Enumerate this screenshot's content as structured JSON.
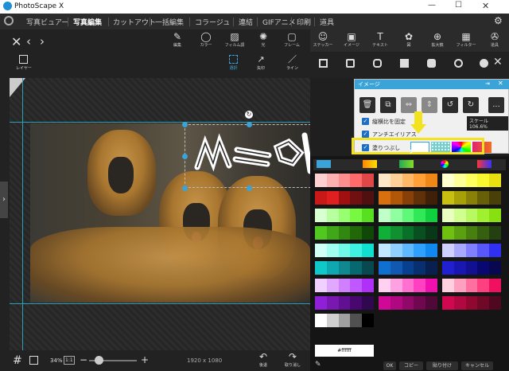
{
  "app": {
    "title": "PhotoScape X",
    "minimize": "—",
    "maximize": "☐",
    "close": "✕"
  },
  "menu": [
    "写真ビュアー",
    "写真編集",
    "カットアウト",
    "一括編集",
    "コラージュ",
    "連結",
    "GIFアニメ",
    "印刷",
    "道具"
  ],
  "toolbar": {
    "items": [
      {
        "label": "編集",
        "icon": "✎"
      },
      {
        "label": "カラー",
        "icon": "◯"
      },
      {
        "label": "フィルム調",
        "icon": "▨"
      },
      {
        "label": "光",
        "icon": "✺"
      },
      {
        "label": "フレーム",
        "icon": "▢"
      },
      {
        "label": "ステッカー",
        "icon": "☺"
      },
      {
        "label": "イメージ",
        "icon": "▣"
      },
      {
        "label": "テキスト",
        "icon": "T"
      },
      {
        "label": "図",
        "icon": "✿"
      },
      {
        "label": "拡大鏡",
        "icon": "⊕"
      },
      {
        "label": "フィルター",
        "icon": "▦"
      },
      {
        "label": "道具",
        "icon": "✇"
      }
    ]
  },
  "subtool": {
    "layer": "レイヤー",
    "select": "選択",
    "arrow": "矢印",
    "line": "ライン"
  },
  "bottom": {
    "zoom": "34%",
    "ratio": "1:1",
    "size": "1920 x 1080",
    "undo": "後退",
    "redo": "取り消し"
  },
  "panel": {
    "header": "イメージ",
    "opt_aspect": "縦横比を固定",
    "opt_antialias": "アンチエイリアス",
    "opt_fill": "塗りつぶし",
    "scale": "スケール 106.6%",
    "more": "..."
  },
  "palette": {
    "hex": "#ffffff",
    "ok": "OK",
    "copy": "コピー",
    "paste": "貼り付け",
    "cancel": "キャンセル"
  },
  "colors": {
    "accent": "#3aa3d8",
    "highlight": "#f2e21f",
    "guide": "#2aa0b8",
    "active_check": "#1b6fc6"
  },
  "icons": [
    "back-icon",
    "prev-icon",
    "next-icon",
    "gear-icon",
    "layer-icon",
    "select-icon",
    "arrow-icon",
    "line-icon",
    "grid-icon",
    "undo-icon",
    "redo-icon",
    "pin-icon",
    "close-icon",
    "trash-icon",
    "duplicate-icon",
    "rotate-left-icon",
    "rotate-right-icon",
    "eyedropper-icon"
  ]
}
